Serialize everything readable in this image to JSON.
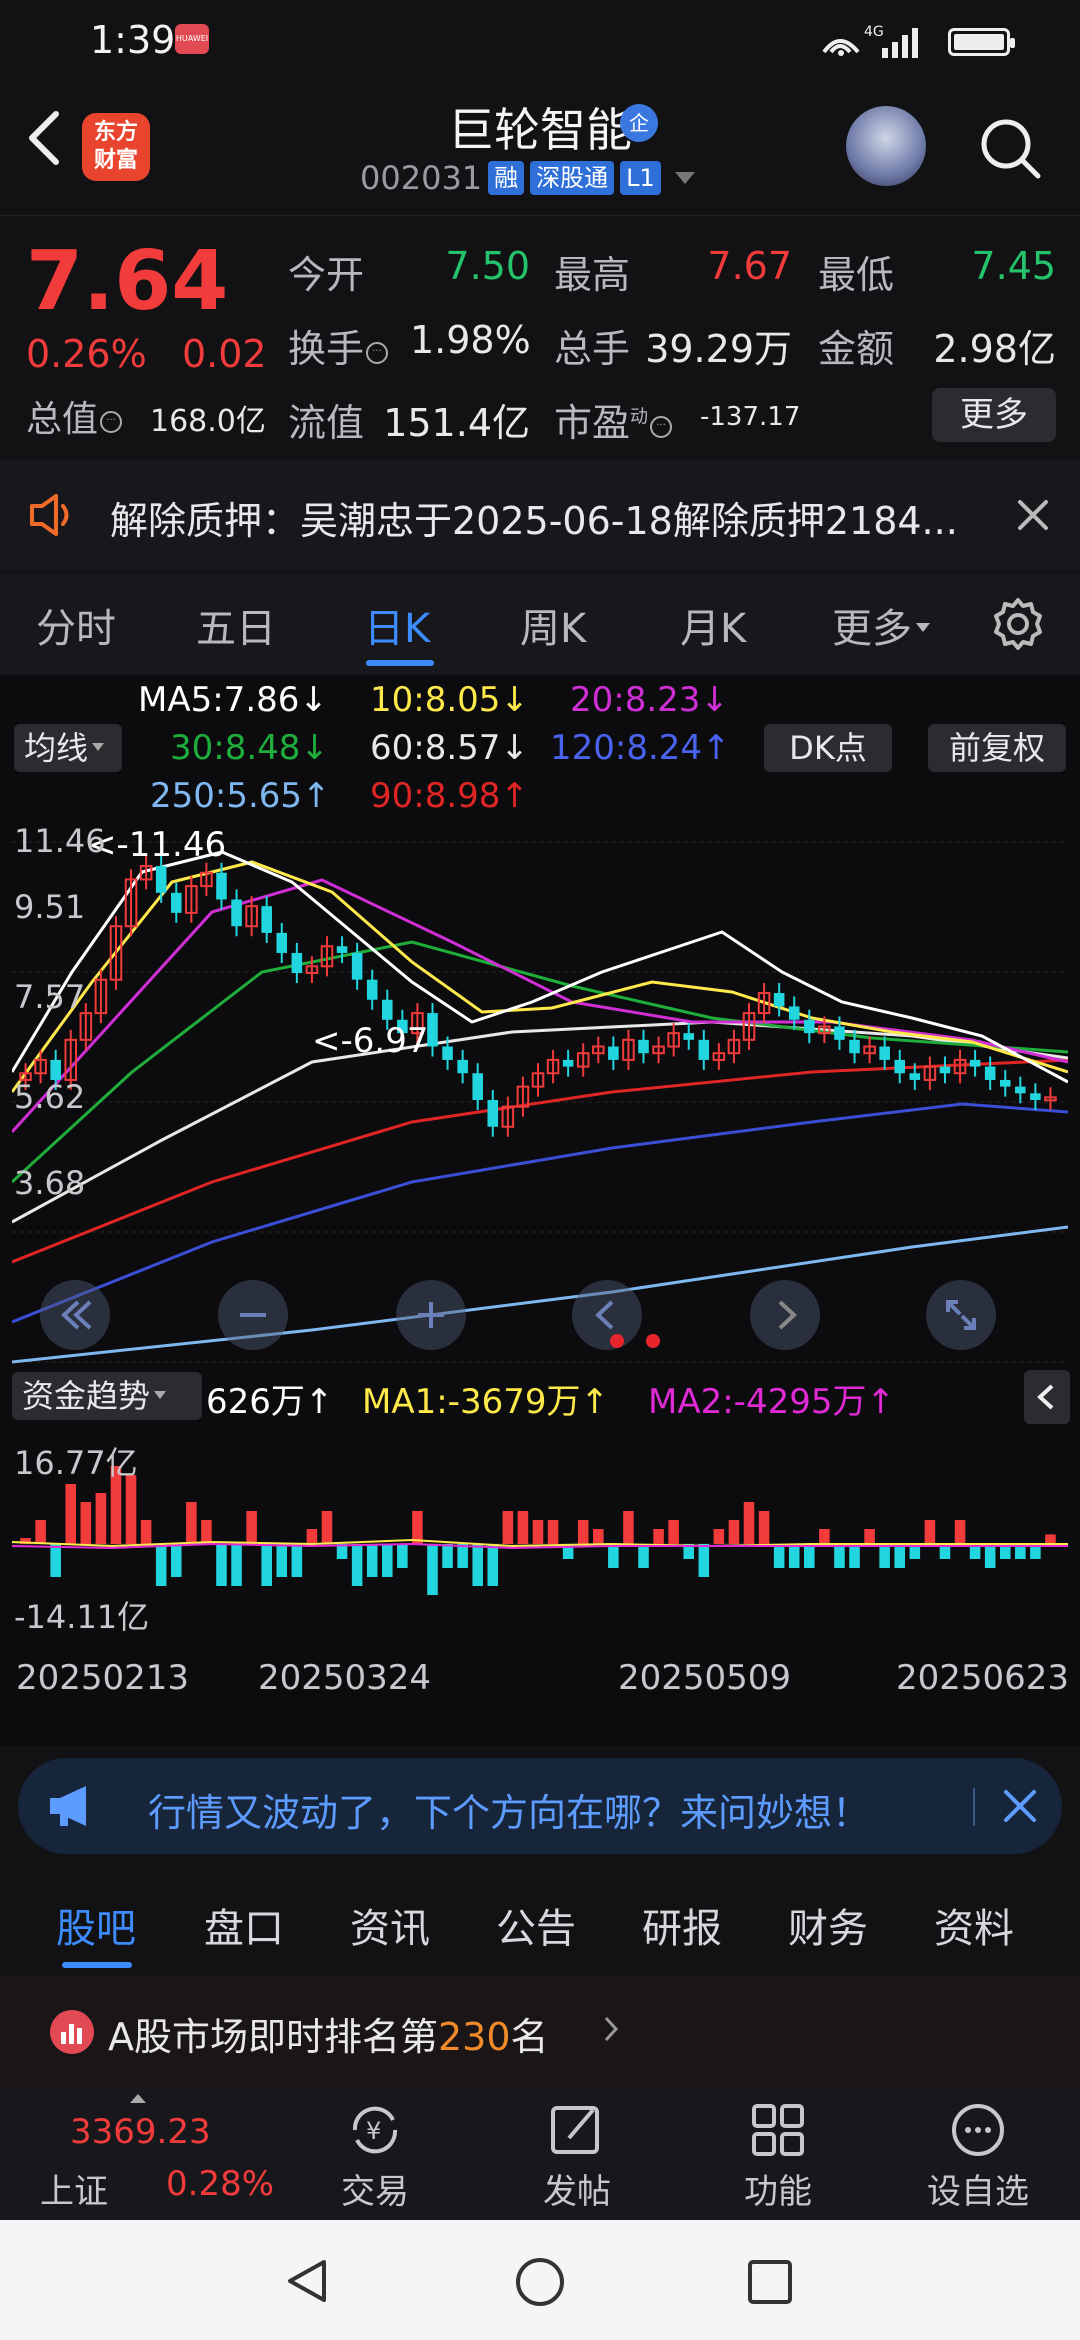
{
  "status": {
    "time": "1:39",
    "badge": "HUAWEI",
    "network": "4G"
  },
  "header": {
    "logo_line1": "东方",
    "logo_line2": "财富",
    "stock_name": "巨轮智能",
    "name_badge": "企",
    "code": "002031",
    "tags": [
      "融",
      "深股通",
      "L1"
    ]
  },
  "quote": {
    "price": "7.64",
    "change_pct": "0.26%",
    "change": "0.02",
    "open_label": "今开",
    "open": "7.50",
    "high_label": "最高",
    "high": "7.67",
    "low_label": "最低",
    "low": "7.45",
    "turnover_label": "换手",
    "turnover": "1.98%",
    "volume_label": "总手",
    "volume": "39.29万",
    "amount_label": "金额",
    "amount": "2.98亿",
    "mktcap_label": "总值",
    "mktcap": "168.0亿",
    "float_label": "流值",
    "float": "151.4亿",
    "pe_label": "市盈",
    "pe_sup": "动",
    "pe": "-137.17",
    "more": "更多"
  },
  "notice": {
    "text": "解除质押：吴潮忠于2025-06-18解除质押2184..."
  },
  "period_tabs": [
    {
      "label": "分时",
      "active": false
    },
    {
      "label": "五日",
      "active": false
    },
    {
      "label": "日K",
      "active": true
    },
    {
      "label": "周K",
      "active": false
    },
    {
      "label": "月K",
      "active": false
    },
    {
      "label": "更多",
      "active": false
    }
  ],
  "ma": {
    "select": "均线",
    "ma5": "MA5:7.86↓",
    "ma10": "10:8.05↓",
    "ma20": "20:8.23↓",
    "ma30": "30:8.48↓",
    "ma60": "60:8.57↓",
    "ma120": "120:8.24↑",
    "ma250": "250:5.65↑",
    "ma90": "90:8.98↑",
    "dk": "DK点",
    "fq": "前复权"
  },
  "colors": {
    "up": "#f23b3b",
    "down": "#25c36b",
    "ma5": "#ffffff",
    "ma10": "#ffe94a",
    "ma20": "#d02fd6",
    "ma30": "#1fae3c",
    "ma60": "#e8e8e8",
    "ma120": "#3a4fd6",
    "ma250": "#7fb8f0",
    "ma90": "#e02525",
    "candle_down": "#22d6e0",
    "accent": "#3c8bff"
  },
  "chart_data": {
    "type": "candlestick",
    "y_ticks": [
      "11.46",
      "9.51",
      "7.57",
      "5.62",
      "3.68"
    ],
    "ylim": [
      3.68,
      11.46
    ],
    "max_label": "<-11.46",
    "min_label": "<-6.97",
    "x_ticks": [
      "20250213",
      "20250324",
      "20250509",
      "20250623"
    ],
    "close_series": [
      8.0,
      8.2,
      7.9,
      8.5,
      8.9,
      9.4,
      10.2,
      10.9,
      11.1,
      10.7,
      10.4,
      10.8,
      11.0,
      10.6,
      10.2,
      10.5,
      10.1,
      9.8,
      9.5,
      9.6,
      9.9,
      9.8,
      9.4,
      9.1,
      8.8,
      8.6,
      8.9,
      8.4,
      8.2,
      8.0,
      7.6,
      7.2,
      7.5,
      7.8,
      8.0,
      8.2,
      8.1,
      8.3,
      8.4,
      8.2,
      8.5,
      8.3,
      8.4,
      8.6,
      8.5,
      8.2,
      8.3,
      8.5,
      8.9,
      9.2,
      9.0,
      8.8,
      8.6,
      8.7,
      8.5,
      8.3,
      8.4,
      8.2,
      8.0,
      7.9,
      8.1,
      8.0,
      8.2,
      8.1,
      7.9,
      7.8,
      7.7,
      7.6,
      7.64
    ]
  },
  "fund": {
    "select": "资金趋势",
    "value": "626万↑",
    "ma1": "MA1:-3679万↑",
    "ma2": "MA2:-4295万↑",
    "y_top": "16.77亿",
    "y_bottom": "-14.11亿"
  },
  "ad": {
    "text": "行情又波动了，下个方向在哪？来问妙想！"
  },
  "bottom_tabs": [
    {
      "label": "股吧",
      "active": true
    },
    {
      "label": "盘口",
      "active": false
    },
    {
      "label": "资讯",
      "active": false
    },
    {
      "label": "公告",
      "active": false
    },
    {
      "label": "研报",
      "active": false
    },
    {
      "label": "财务",
      "active": false
    },
    {
      "label": "资料",
      "active": false
    }
  ],
  "rank": {
    "prefix": "A股市场即时排名第",
    "num": "230",
    "suffix": "名"
  },
  "footer": {
    "index_value": "3369.23",
    "index_name": "上证",
    "index_pct": "0.28%",
    "tabs": [
      {
        "label": "交易",
        "icon": "trade-icon"
      },
      {
        "label": "发帖",
        "icon": "edit-icon"
      },
      {
        "label": "功能",
        "icon": "grid-icon"
      },
      {
        "label": "设自选",
        "icon": "more-circle-icon"
      }
    ]
  }
}
